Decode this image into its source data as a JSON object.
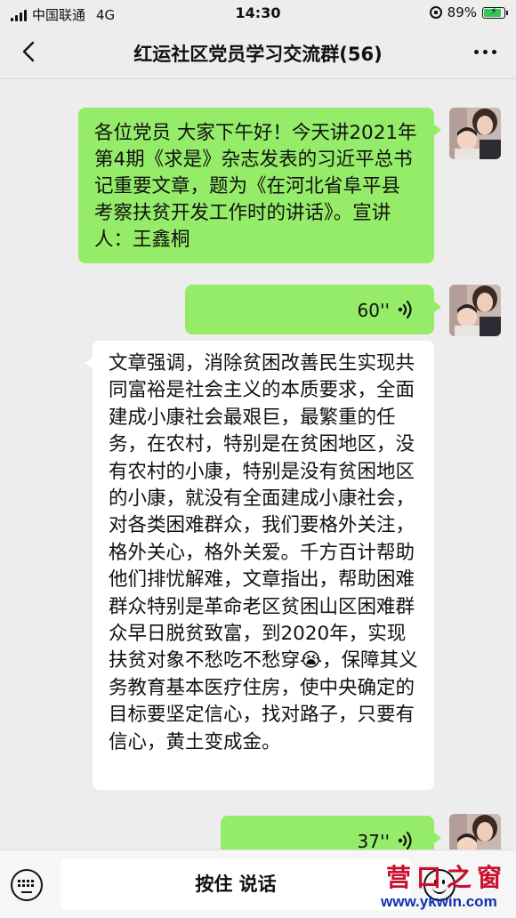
{
  "status_bar": {
    "carrier": "中国联通",
    "network": "4G",
    "time": "14:30",
    "battery_percent": "89%",
    "battery_level": 0.89
  },
  "nav": {
    "title": "红运社区党员学习交流群(56)",
    "back_icon": "chevron-left-icon",
    "more_icon": "more-dots-icon"
  },
  "colors": {
    "sent_bubble": "#95ec69",
    "received_bubble": "#ffffff",
    "chat_background": "#ededed"
  },
  "messages": [
    {
      "type": "text",
      "direction": "sent",
      "text": "各位党员 大家下午好！今天讲2021年第4期《求是》杂志发表的习近平总书记重要文章，题为《在河北省阜平县考察扶贫开发工作时的讲话》。宣讲人：王鑫桐"
    },
    {
      "type": "voice",
      "direction": "sent",
      "duration": "60''"
    },
    {
      "type": "text",
      "direction": "received",
      "text_before_emoji": "文章强调，消除贫困改善民生实现共同富裕是社会主义的本质要求，全面建成小康社会最艰巨，最繁重的任务，在农村，特别是在贫困地区，没有农村的小康，特别是没有贫困地区的小康，就没有全面建成小康社会，对各类困难群众，我们要格外关注，格外关心，格外关爱。千方百计帮助他们排忧解难，文章指出，帮助困难群众特别是革命老区贫困山区困难群众早日脱贫致富，到2020年，实现扶贫对象不愁吃不愁穿",
      "emoji": "😭",
      "text_after_emoji": "，保障其义务教育基本医疗住房，使中央确定的目标要坚定信心，找对路子，只要有信心，黄土变成金。"
    },
    {
      "type": "voice",
      "direction": "sent",
      "duration": "37''"
    }
  ],
  "input_bar": {
    "hold_to_talk": "按住 说话",
    "left_icon": "keyboard-icon",
    "right_icon": "emoji-icon"
  },
  "watermark": {
    "url": "www.ykwin.com"
  }
}
